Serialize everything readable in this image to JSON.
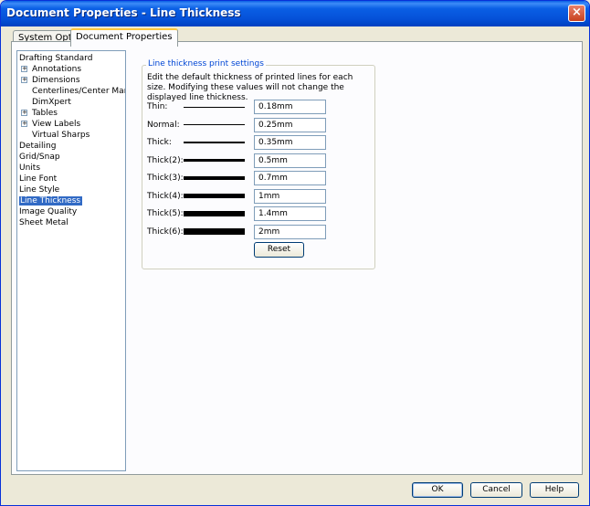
{
  "window": {
    "title": "Document Properties - Line Thickness",
    "close_glyph": "×"
  },
  "tabs": [
    {
      "label": "System Options",
      "active": false
    },
    {
      "label": "Document Properties",
      "active": true
    }
  ],
  "tree": {
    "selected": "Line Thickness",
    "items": [
      {
        "label": "Drafting Standard",
        "level": 0,
        "expandable": false
      },
      {
        "label": "Annotations",
        "level": 1,
        "expandable": true
      },
      {
        "label": "Dimensions",
        "level": 1,
        "expandable": true
      },
      {
        "label": "Centerlines/Center Marks",
        "level": 1,
        "expandable": false
      },
      {
        "label": "DimXpert",
        "level": 1,
        "expandable": false
      },
      {
        "label": "Tables",
        "level": 1,
        "expandable": true
      },
      {
        "label": "View Labels",
        "level": 1,
        "expandable": true
      },
      {
        "label": "Virtual Sharps",
        "level": 1,
        "expandable": false
      },
      {
        "label": "Detailing",
        "level": 0,
        "expandable": false
      },
      {
        "label": "Grid/Snap",
        "level": 0,
        "expandable": false
      },
      {
        "label": "Units",
        "level": 0,
        "expandable": false
      },
      {
        "label": "Line Font",
        "level": 0,
        "expandable": false
      },
      {
        "label": "Line Style",
        "level": 0,
        "expandable": false
      },
      {
        "label": "Line Thickness",
        "level": 0,
        "expandable": false
      },
      {
        "label": "Image Quality",
        "level": 0,
        "expandable": false
      },
      {
        "label": "Sheet Metal",
        "level": 0,
        "expandable": false
      }
    ]
  },
  "group": {
    "title": "Line thickness print settings",
    "description": "Edit the default thickness of printed lines for each size.  Modifying these values will not change the displayed line thickness.",
    "rows": [
      {
        "label": "Thin:",
        "value": "0.18mm"
      },
      {
        "label": "Normal:",
        "value": "0.25mm"
      },
      {
        "label": "Thick:",
        "value": "0.35mm"
      },
      {
        "label": "Thick(2):",
        "value": "0.5mm"
      },
      {
        "label": "Thick(3):",
        "value": "0.7mm"
      },
      {
        "label": "Thick(4):",
        "value": "1mm"
      },
      {
        "label": "Thick(5):",
        "value": "1.4mm"
      },
      {
        "label": "Thick(6):",
        "value": "2mm"
      }
    ],
    "reset_label": "Reset"
  },
  "footer": {
    "ok_label": "OK",
    "cancel_label": "Cancel",
    "help_label": "Help"
  }
}
